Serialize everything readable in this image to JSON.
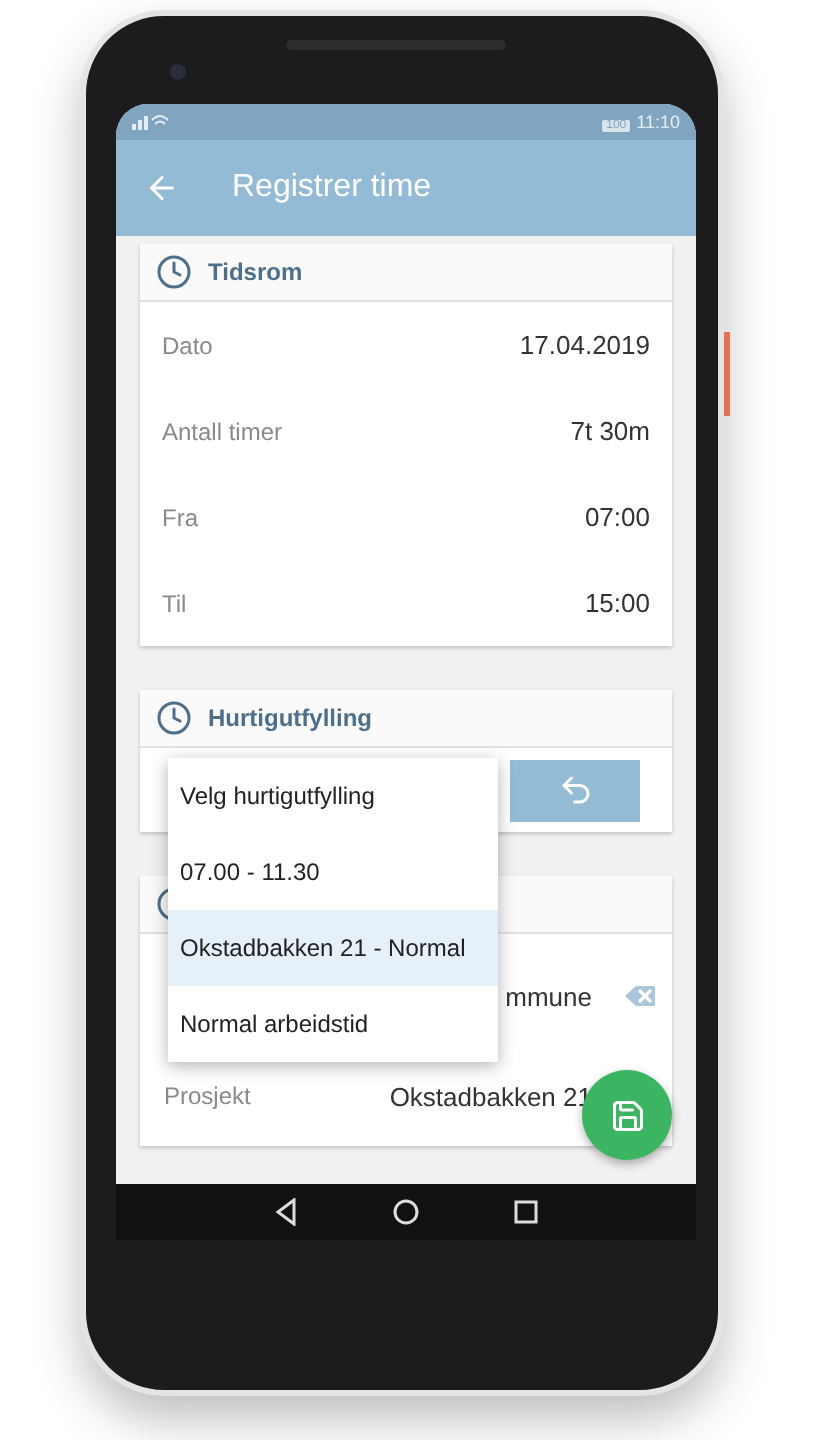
{
  "status_bar": {
    "battery": "100",
    "time": "11:10"
  },
  "app_bar": {
    "title": "Registrer time"
  },
  "period_card": {
    "title": "Tidsrom",
    "rows": [
      {
        "label": "Dato",
        "value": "17.04.2019"
      },
      {
        "label": "Antall timer",
        "value": "7t 30m"
      },
      {
        "label": "Fra",
        "value": "07:00"
      },
      {
        "label": "Til",
        "value": "15:00"
      }
    ]
  },
  "quickfill_card": {
    "title": "Hurtigutfylling"
  },
  "details_card": {
    "rows": [
      {
        "value": "mmune",
        "clearable": true
      },
      {
        "label": "Prosjekt",
        "value": "Okstadbakken 21",
        "clearable": false
      }
    ]
  },
  "dropdown": {
    "items": [
      {
        "label": "Velg hurtigutfylling",
        "selected": false
      },
      {
        "label": "07.00 - 11.30",
        "selected": false
      },
      {
        "label": "Okstadbakken 21 - Normal",
        "selected": true
      },
      {
        "label": "Normal arbeidstid",
        "selected": false
      }
    ]
  }
}
